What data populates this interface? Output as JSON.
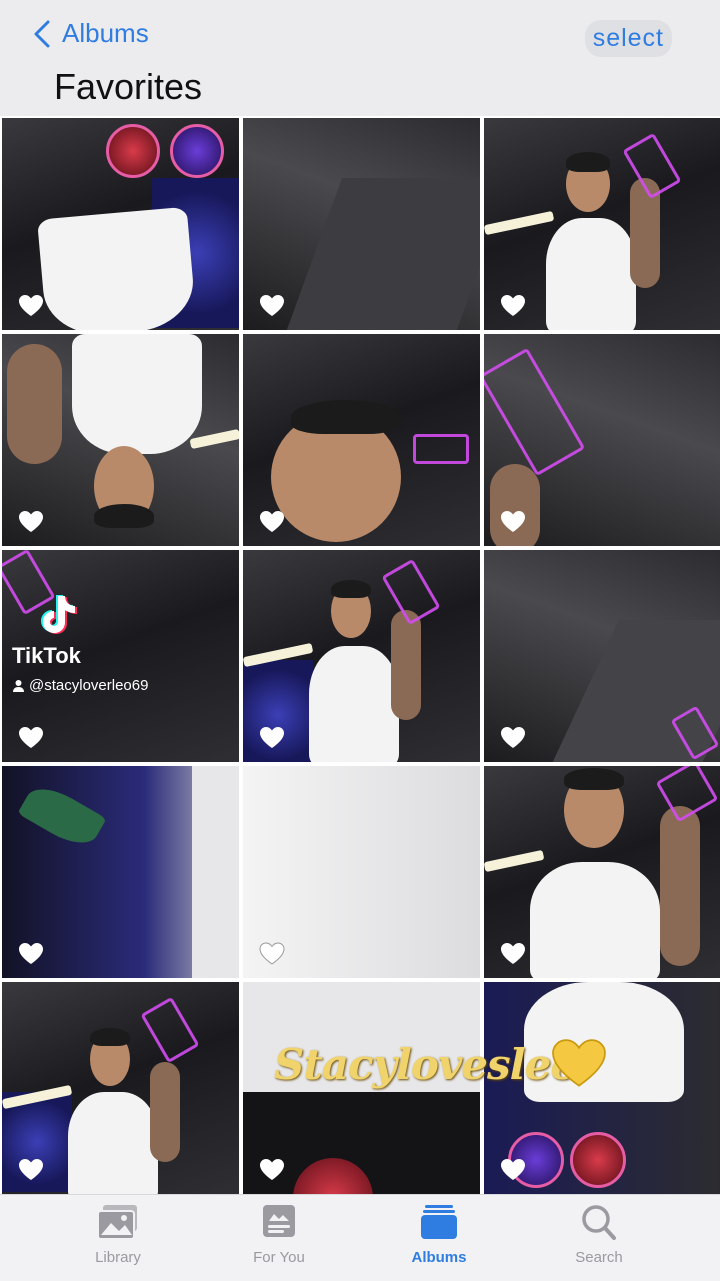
{
  "header": {
    "back_label": "Albums",
    "select_label": "select",
    "title": "Favorites"
  },
  "overlay": {
    "tiktok_brand": "TikTok",
    "tiktok_user": "@stacyloverleo69",
    "watermark": "Stacylovesleo"
  },
  "tabs": [
    {
      "label": "Library",
      "icon": "photo-stack-icon",
      "active": false
    },
    {
      "label": "For You",
      "icon": "for-you-icon",
      "active": false
    },
    {
      "label": "Albums",
      "icon": "albums-folder-icon",
      "active": true
    },
    {
      "label": "Search",
      "icon": "search-icon",
      "active": false
    }
  ],
  "colors": {
    "accent": "#2f7de1",
    "inactive_tab": "#9a9aa0",
    "watermark": "#f0d36a",
    "neon": "#d34cf0"
  },
  "photos": [
    {
      "favorited": true
    },
    {
      "favorited": true
    },
    {
      "favorited": true
    },
    {
      "favorited": true
    },
    {
      "favorited": true
    },
    {
      "favorited": true
    },
    {
      "favorited": true
    },
    {
      "favorited": true
    },
    {
      "favorited": true
    },
    {
      "favorited": true
    },
    {
      "favorited": true
    },
    {
      "favorited": true
    },
    {
      "favorited": true
    },
    {
      "favorited": true
    },
    {
      "favorited": true
    }
  ]
}
